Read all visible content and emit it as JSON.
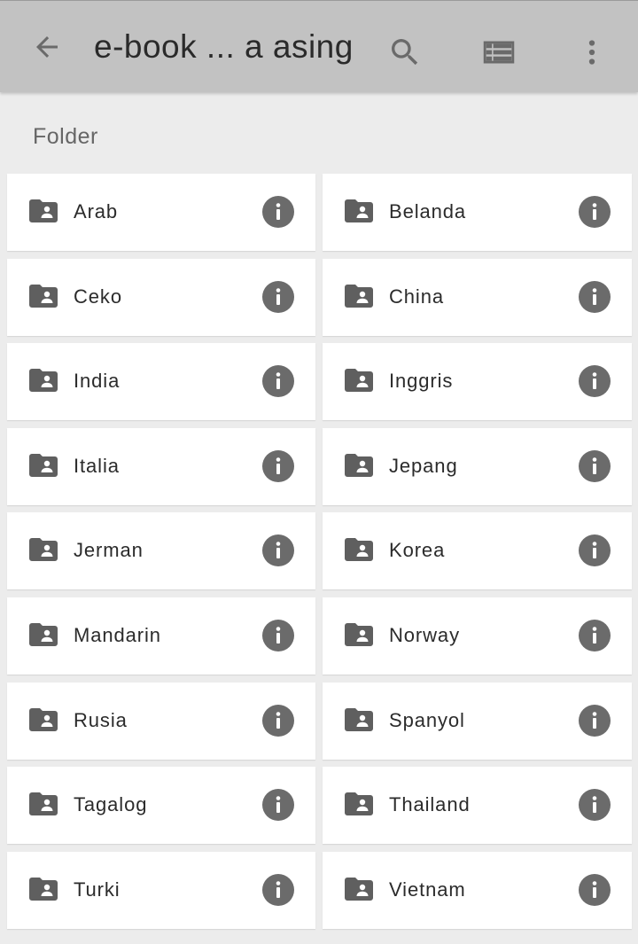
{
  "toolbar": {
    "title": "e-book ... a asing",
    "back_icon": "arrow-back-icon",
    "search_icon": "search-icon",
    "view_icon": "list-view-icon",
    "more_icon": "more-vertical-icon"
  },
  "section": {
    "header": "Folder"
  },
  "folders": [
    {
      "label": "Arab"
    },
    {
      "label": "Belanda"
    },
    {
      "label": "Ceko"
    },
    {
      "label": "China"
    },
    {
      "label": "India"
    },
    {
      "label": "Inggris"
    },
    {
      "label": "Italia"
    },
    {
      "label": "Jepang"
    },
    {
      "label": "Jerman"
    },
    {
      "label": "Korea"
    },
    {
      "label": "Mandarin"
    },
    {
      "label": "Norway"
    },
    {
      "label": "Rusia"
    },
    {
      "label": "Spanyol"
    },
    {
      "label": "Tagalog"
    },
    {
      "label": "Thailand"
    },
    {
      "label": "Turki"
    },
    {
      "label": "Vietnam"
    }
  ],
  "colors": {
    "toolbar_bg": "#c2c2c2",
    "page_bg": "#ececec",
    "card_bg": "#ffffff",
    "icon_gray": "#676767"
  }
}
